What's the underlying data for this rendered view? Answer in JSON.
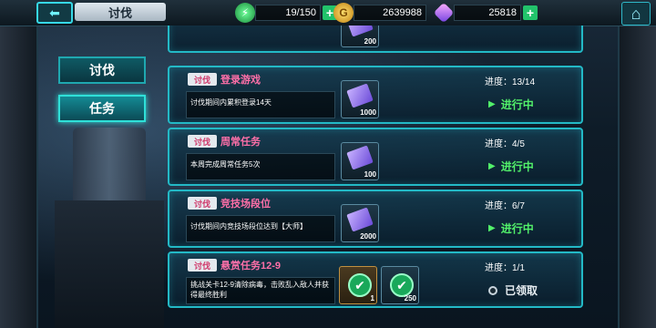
{
  "header": {
    "back_icon": "back-arrow-icon",
    "title": "讨伐",
    "energy": {
      "icon": "energy-icon",
      "value": "19/150",
      "color": "#3ad26a"
    },
    "gold": {
      "icon": "gold-coin-icon",
      "symbol": "G",
      "value": "2639988",
      "color": "#f0c030"
    },
    "gems": {
      "icon": "gem-icon",
      "value": "25818",
      "color": "#d070ff"
    },
    "home_icon": "home-icon"
  },
  "tabs": [
    {
      "label": "讨伐",
      "active": false
    },
    {
      "label": "任务",
      "active": true
    }
  ],
  "partial_top": {
    "amount": "200"
  },
  "tasks": [
    {
      "tag": "讨伐",
      "name": "登录游戏",
      "desc": "讨伐期间内累积登录14天",
      "progress": "进度：13/14",
      "status": "进行中",
      "rewards": [
        {
          "icon": "ticket-icon",
          "amount": "1000"
        }
      ]
    },
    {
      "tag": "讨伐",
      "name": "周常任务",
      "desc": "本周完成周常任务5次",
      "progress": "进度：4/5",
      "status": "进行中",
      "rewards": [
        {
          "icon": "ticket-icon",
          "amount": "100"
        }
      ]
    },
    {
      "tag": "讨伐",
      "name": "竞技场段位",
      "desc": "讨伐期间内竞技场段位达到【大师】",
      "progress": "进度：6/7",
      "status": "进行中",
      "rewards": [
        {
          "icon": "ticket-icon",
          "amount": "2000"
        }
      ]
    },
    {
      "tag": "讨伐",
      "name": "悬赏任务12-9",
      "desc": "挑战关卡12-9清除病毒，击败乱入敌人并获得最终胜利",
      "progress": "进度：1/1",
      "status": "已领取",
      "rewards": [
        {
          "icon": "check-badge-icon",
          "amount": "1"
        },
        {
          "icon": "check-badge-icon",
          "amount": "250"
        }
      ]
    }
  ]
}
